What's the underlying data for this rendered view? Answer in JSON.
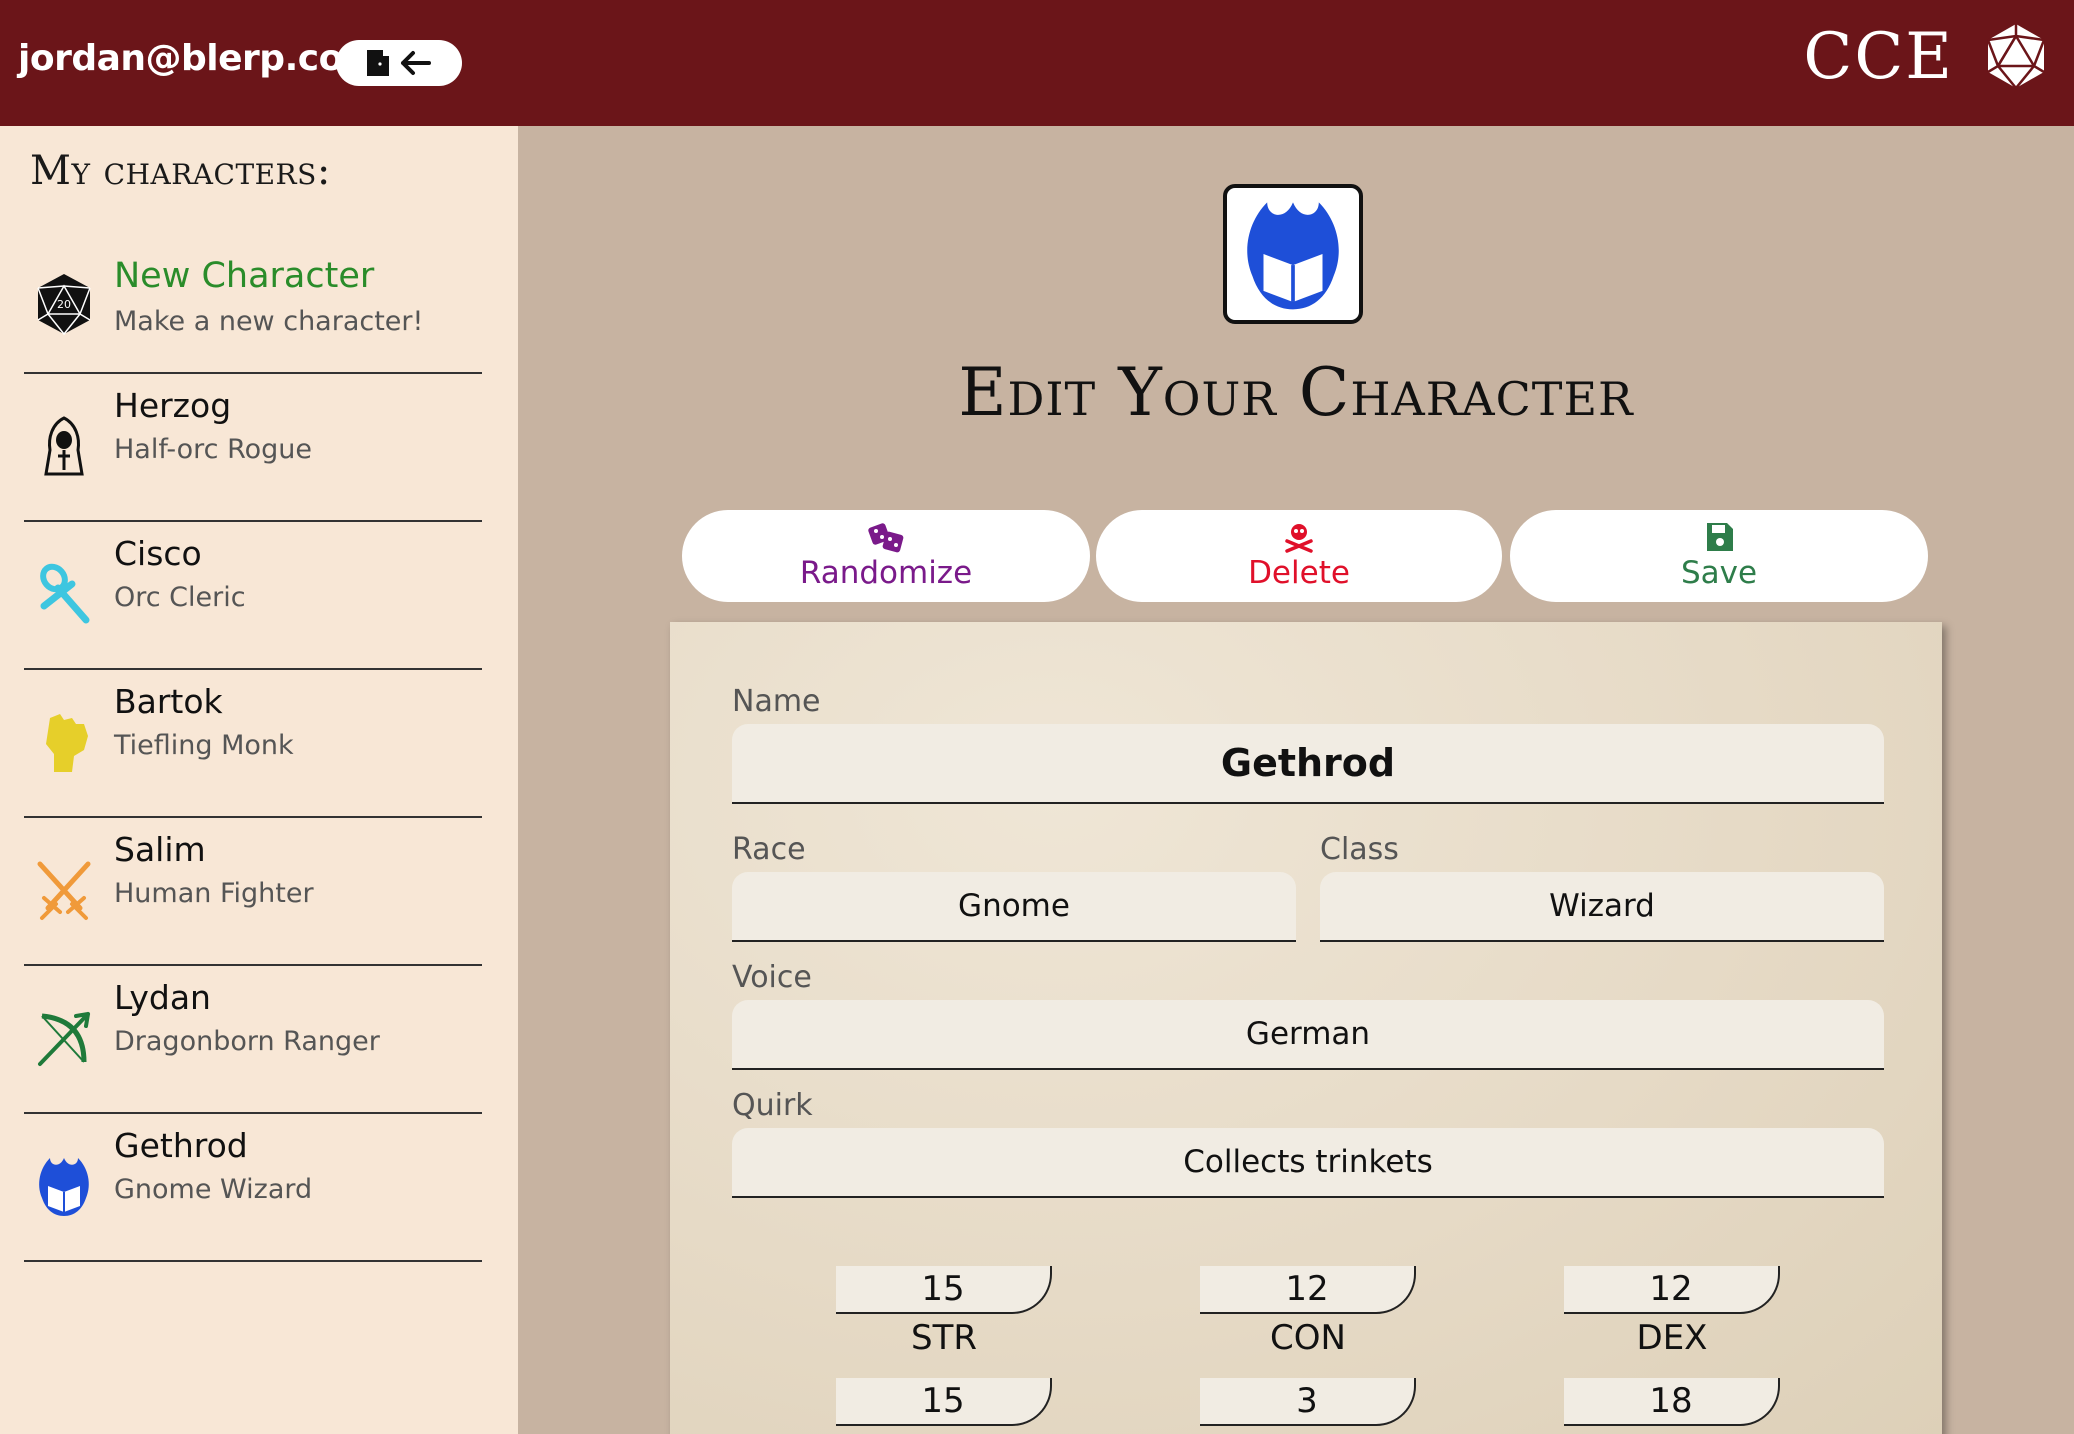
{
  "header": {
    "user_email": "jordan@blerp.com",
    "brand": "CCE"
  },
  "sidebar": {
    "title": "My characters:",
    "items": [
      {
        "name": "New Character",
        "subtitle": "Make a new character!",
        "icon": "d20-icon",
        "color": "#2a8c2a"
      },
      {
        "name": "Herzog",
        "subtitle": "Half-orc Rogue",
        "icon": "hooded-figure-icon",
        "color": "#111111"
      },
      {
        "name": "Cisco",
        "subtitle": "Orc Cleric",
        "icon": "ankh-icon",
        "color": "#3ec6e0"
      },
      {
        "name": "Bartok",
        "subtitle": "Tiefling Monk",
        "icon": "fist-icon",
        "color": "#e6cf2a"
      },
      {
        "name": "Salim",
        "subtitle": "Human Fighter",
        "icon": "crossed-swords-icon",
        "color": "#f09a3a"
      },
      {
        "name": "Lydan",
        "subtitle": "Dragonborn Ranger",
        "icon": "bow-arrow-icon",
        "color": "#1f7a3a"
      },
      {
        "name": "Gethrod",
        "subtitle": "Gnome Wizard",
        "icon": "flaming-book-icon",
        "color": "#1e4fd8"
      }
    ]
  },
  "main": {
    "title": "Edit Your Character",
    "actions": {
      "randomize": "Randomize",
      "delete": "Delete",
      "save": "Save"
    },
    "form": {
      "name_label": "Name",
      "name_value": "Gethrod",
      "race_label": "Race",
      "race_value": "Gnome",
      "class_label": "Class",
      "class_value": "Wizard",
      "voice_label": "Voice",
      "voice_value": "German",
      "quirk_label": "Quirk",
      "quirk_value": "Collects trinkets"
    },
    "stats": [
      {
        "name": "STR",
        "value": "15"
      },
      {
        "name": "CON",
        "value": "12"
      },
      {
        "name": "DEX",
        "value": "12"
      },
      {
        "name": "",
        "value": "15"
      },
      {
        "name": "",
        "value": "3"
      },
      {
        "name": "",
        "value": "18"
      }
    ]
  }
}
